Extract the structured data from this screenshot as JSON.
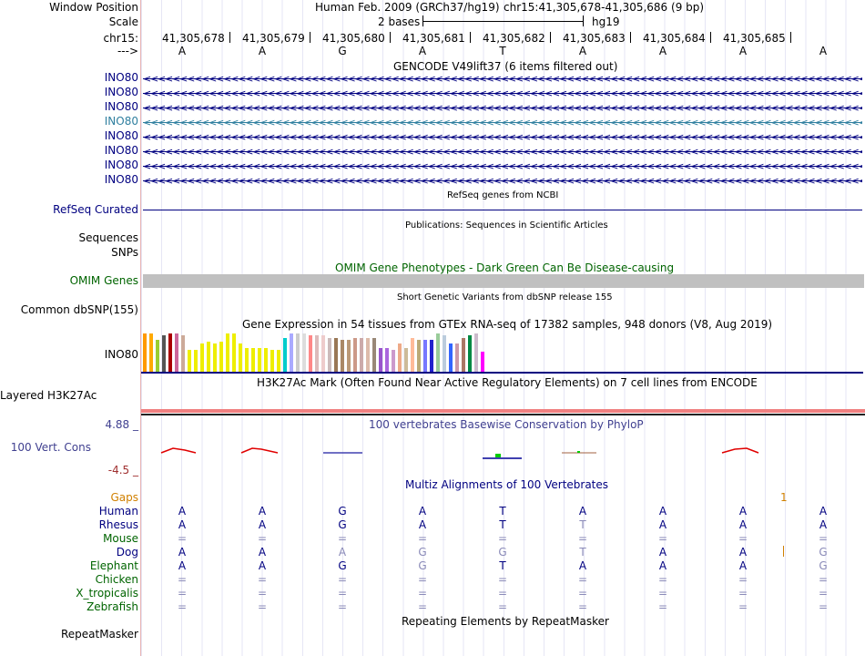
{
  "header": {
    "window_position_label": "Window Position",
    "assembly": "Human Feb. 2009 (GRCh37/hg19)",
    "position": "chr15:41,305,678-41,305,686 (9 bp)",
    "scale_label": "Scale",
    "scale_text": "2 bases",
    "scale_db": "hg19",
    "chrom_label": "chr15:",
    "strand_label": "--->",
    "coords": [
      "41,305,678",
      "41,305,679",
      "41,305,680",
      "41,305,681",
      "41,305,682",
      "41,305,683",
      "41,305,684",
      "41,305,685"
    ],
    "bases": [
      "A",
      "A",
      "G",
      "A",
      "T",
      "A",
      "A",
      "A",
      "A"
    ]
  },
  "gencode": {
    "title": "GENCODE V49lift37 (6 items filtered out)",
    "transcripts": [
      "INO80",
      "INO80",
      "INO80",
      "INO80",
      "INO80",
      "INO80",
      "INO80",
      "INO80"
    ],
    "highlighted_index": 3
  },
  "refseq": {
    "title": "RefSeq genes from NCBI",
    "label": "RefSeq Curated"
  },
  "publications": {
    "title": "Publications: Sequences in Scientific Articles",
    "label1": "Sequences",
    "label2": "SNPs"
  },
  "omim": {
    "title": "OMIM Gene Phenotypes - Dark Green Can Be Disease-causing",
    "label": "OMIM Genes"
  },
  "dbsnp": {
    "title": "Short Genetic Variants from dbSNP release 155",
    "label": "Common dbSNP(155)"
  },
  "gtex": {
    "title": "Gene Expression in 54 tissues from GTEx RNA-seq of 17382 samples, 948 donors (V8, Aug 2019)",
    "label": "INO80",
    "tissue_levels": [
      0.95,
      0.95,
      0.8,
      0.9,
      0.95,
      0.95,
      0.9,
      0.55,
      0.55,
      0.7,
      0.75,
      0.7,
      0.75,
      0.95,
      0.95,
      0.7,
      0.6,
      0.6,
      0.6,
      0.6,
      0.55,
      0.55,
      0.85,
      0.95,
      0.95,
      0.95,
      0.9,
      0.9,
      0.9,
      0.85,
      0.85,
      0.8,
      0.8,
      0.85,
      0.85,
      0.85,
      0.85,
      0.6,
      0.6,
      0.55,
      0.7,
      0.6,
      0.85,
      0.8,
      0.8,
      0.8,
      0.95,
      0.9,
      0.7,
      0.7,
      0.85,
      0.9,
      0.95,
      0.5
    ],
    "tissue_colors": [
      "#ff9900",
      "#ffaa00",
      "#9acd32",
      "#555555",
      "#aa0000",
      "#cc6699",
      "#ccaa99",
      "#eeee00",
      "#eeee00",
      "#eeee00",
      "#eeee00",
      "#eeee00",
      "#eeee00",
      "#eeee00",
      "#eeee00",
      "#eeee00",
      "#eeee00",
      "#eeee00",
      "#eeee00",
      "#eeee00",
      "#eeee00",
      "#eeee00",
      "#00cccc",
      "#aaaaff",
      "#cccccc",
      "#dddddd",
      "#ff8888",
      "#ddbbbb",
      "#eecccc",
      "#ccbbbb",
      "#997755",
      "#aa8866",
      "#bb9977",
      "#cc9988",
      "#ccaaaa",
      "#ddbbaa",
      "#998877",
      "#9955cc",
      "#aa66dd",
      "#cc99cc",
      "#eeaa88",
      "#ccbb99",
      "#ffbb99",
      "#bbaa77",
      "#7777ff",
      "#2222cc",
      "#99cc99",
      "#bbccdd",
      "#3366ff",
      "#cc99aa",
      "#aa7766",
      "#008844",
      "#ccbbcc",
      "#ff00ff"
    ]
  },
  "h3k27ac": {
    "title": "H3K27Ac Mark (Often Found Near Active Regulatory Elements) on 7 cell lines from ENCODE",
    "label": "Layered H3K27Ac"
  },
  "phylop": {
    "title": "100 vertebrates Basewise Conservation by PhyloP",
    "label": "100 Vert. Cons",
    "max": "4.88 _",
    "min": "-4.5 _"
  },
  "multiz": {
    "title": "Multiz Alignments of 100 Vertebrates",
    "gaps_label": "Gaps",
    "gaps_mark": "1",
    "species": [
      {
        "name": "Human",
        "bases": [
          "A",
          "A",
          "G",
          "A",
          "T",
          "A",
          "A",
          "A",
          "A"
        ],
        "dim": [
          0,
          0,
          0,
          0,
          0,
          0,
          0,
          0,
          0
        ]
      },
      {
        "name": "Rhesus",
        "bases": [
          "A",
          "A",
          "G",
          "A",
          "T",
          "T",
          "A",
          "A",
          "A"
        ],
        "dim": [
          0,
          0,
          0,
          0,
          0,
          1,
          0,
          0,
          0
        ]
      },
      {
        "name": "Mouse",
        "bases": [
          "=",
          "=",
          "=",
          "=",
          "=",
          "=",
          "=",
          "=",
          "="
        ],
        "dim": [
          1,
          1,
          1,
          1,
          1,
          1,
          1,
          1,
          1
        ]
      },
      {
        "name": "Dog",
        "bases": [
          "A",
          "A",
          "A",
          "G",
          "G",
          "T",
          "A",
          "A",
          "G"
        ],
        "dim": [
          0,
          0,
          1,
          1,
          1,
          1,
          0,
          0,
          1
        ]
      },
      {
        "name": "Elephant",
        "bases": [
          "A",
          "A",
          "G",
          "G",
          "T",
          "A",
          "A",
          "A",
          "G"
        ],
        "dim": [
          0,
          0,
          0,
          1,
          0,
          0,
          0,
          0,
          1
        ]
      },
      {
        "name": "Chicken",
        "bases": [
          "=",
          "=",
          "=",
          "=",
          "=",
          "=",
          "=",
          "=",
          "="
        ],
        "dim": [
          1,
          1,
          1,
          1,
          1,
          1,
          1,
          1,
          1
        ]
      },
      {
        "name": "X_tropicalis",
        "bases": [
          "=",
          "=",
          "=",
          "=",
          "=",
          "=",
          "=",
          "=",
          "="
        ],
        "dim": [
          1,
          1,
          1,
          1,
          1,
          1,
          1,
          1,
          1
        ]
      },
      {
        "name": "Zebrafish",
        "bases": [
          "=",
          "=",
          "=",
          "=",
          "=",
          "=",
          "=",
          "=",
          "="
        ],
        "dim": [
          1,
          1,
          1,
          1,
          1,
          1,
          1,
          1,
          1
        ]
      }
    ]
  },
  "repeatmasker": {
    "title": "Repeating Elements by RepeatMasker",
    "label": "RepeatMasker"
  },
  "colors": {
    "navy": "#000080",
    "green": "#006400",
    "highlight": "#2f7f9f",
    "omim_bar": "#c0c0c0",
    "h3k27ac_band": "#f08080",
    "gaps": "#d08000"
  }
}
